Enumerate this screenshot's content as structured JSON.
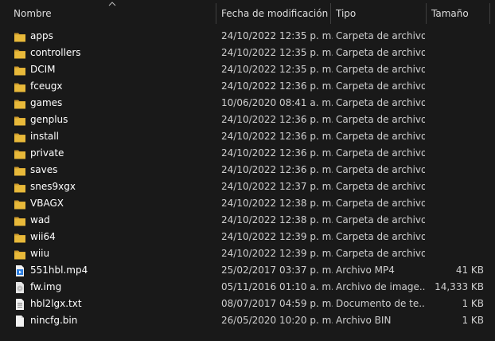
{
  "columns": {
    "name": "Nombre",
    "date": "Fecha de modificación",
    "type": "Tipo",
    "size": "Tamaño"
  },
  "colors": {
    "folder": "#e8b93a",
    "folder_dark": "#c9962a",
    "text": "#ffffff",
    "muted": "#cfcfcf"
  },
  "files": [
    {
      "name": "apps",
      "date": "24/10/2022 12:35 p. m.",
      "type": "Carpeta de archivos",
      "size": "",
      "icon": "folder-icon"
    },
    {
      "name": "controllers",
      "date": "24/10/2022 12:35 p. m.",
      "type": "Carpeta de archivos",
      "size": "",
      "icon": "folder-icon"
    },
    {
      "name": "DCIM",
      "date": "24/10/2022 12:35 p. m.",
      "type": "Carpeta de archivos",
      "size": "",
      "icon": "folder-icon"
    },
    {
      "name": "fceugx",
      "date": "24/10/2022 12:36 p. m.",
      "type": "Carpeta de archivos",
      "size": "",
      "icon": "folder-icon"
    },
    {
      "name": "games",
      "date": "10/06/2020 08:41 a. m.",
      "type": "Carpeta de archivos",
      "size": "",
      "icon": "folder-icon"
    },
    {
      "name": "genplus",
      "date": "24/10/2022 12:36 p. m.",
      "type": "Carpeta de archivos",
      "size": "",
      "icon": "folder-icon"
    },
    {
      "name": "install",
      "date": "24/10/2022 12:36 p. m.",
      "type": "Carpeta de archivos",
      "size": "",
      "icon": "folder-icon"
    },
    {
      "name": "private",
      "date": "24/10/2022 12:36 p. m.",
      "type": "Carpeta de archivos",
      "size": "",
      "icon": "folder-icon"
    },
    {
      "name": "saves",
      "date": "24/10/2022 12:36 p. m.",
      "type": "Carpeta de archivos",
      "size": "",
      "icon": "folder-icon"
    },
    {
      "name": "snes9xgx",
      "date": "24/10/2022 12:37 p. m.",
      "type": "Carpeta de archivos",
      "size": "",
      "icon": "folder-icon"
    },
    {
      "name": "VBAGX",
      "date": "24/10/2022 12:38 p. m.",
      "type": "Carpeta de archivos",
      "size": "",
      "icon": "folder-icon"
    },
    {
      "name": "wad",
      "date": "24/10/2022 12:38 p. m.",
      "type": "Carpeta de archivos",
      "size": "",
      "icon": "folder-icon"
    },
    {
      "name": "wii64",
      "date": "24/10/2022 12:39 p. m.",
      "type": "Carpeta de archivos",
      "size": "",
      "icon": "folder-icon"
    },
    {
      "name": "wiiu",
      "date": "24/10/2022 12:39 p. m.",
      "type": "Carpeta de archivos",
      "size": "",
      "icon": "folder-icon"
    },
    {
      "name": "551hbl.mp4",
      "date": "25/02/2017 03:37 p. m.",
      "type": "Archivo MP4",
      "size": "41 KB",
      "icon": "video-file-icon"
    },
    {
      "name": "fw.img",
      "date": "05/11/2016 01:10 a. m.",
      "type": "Archivo de image...",
      "size": "14,333 KB",
      "icon": "disc-image-file-icon"
    },
    {
      "name": "hbl2lgx.txt",
      "date": "08/07/2017 04:59 p. m.",
      "type": "Documento de te...",
      "size": "1 KB",
      "icon": "text-file-icon"
    },
    {
      "name": "nincfg.bin",
      "date": "26/05/2020 10:20 p. m.",
      "type": "Archivo BIN",
      "size": "1 KB",
      "icon": "generic-file-icon"
    }
  ]
}
